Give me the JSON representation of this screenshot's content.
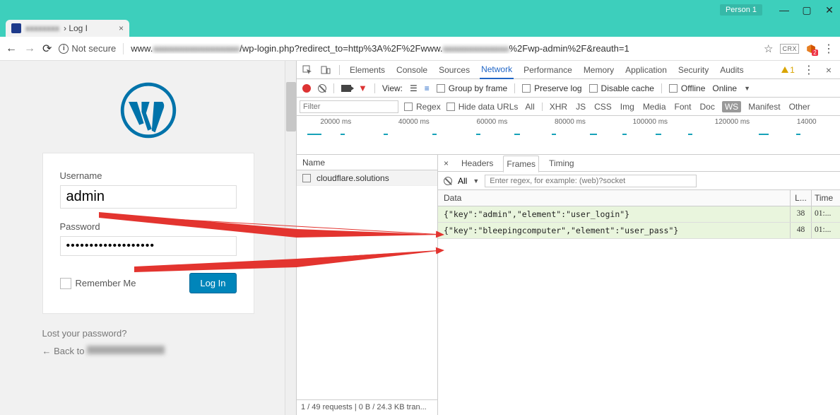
{
  "window": {
    "profile": "Person 1"
  },
  "tab": {
    "title_suffix": "› Log I"
  },
  "omnibox": {
    "security": "Not secure",
    "url_pre": "www.",
    "url_mid": "/wp-login.php?redirect_to=http%3A%2F%2Fwww.",
    "url_suf": "%2Fwp-admin%2F&reauth=1",
    "crx": "CRX",
    "cube_badge": "2"
  },
  "wp": {
    "username_label": "Username",
    "username_value": "admin",
    "password_label": "Password",
    "password_value": "•••••••••••••••••••",
    "remember": "Remember Me",
    "submit": "Log In",
    "lost": "Lost your password?",
    "back": "← Back to"
  },
  "devtools": {
    "tabs": [
      "Elements",
      "Console",
      "Sources",
      "Network",
      "Performance",
      "Memory",
      "Application",
      "Security",
      "Audits"
    ],
    "active_tab": "Network",
    "warn_count": "1",
    "toolbar": {
      "view": "View:",
      "group": "Group by frame",
      "preserve": "Preserve log",
      "disable": "Disable cache",
      "offline": "Offline",
      "online": "Online"
    },
    "filter": {
      "placeholder": "Filter",
      "regex": "Regex",
      "hide": "Hide data URLs",
      "types": [
        "All",
        "XHR",
        "JS",
        "CSS",
        "Img",
        "Media",
        "Font",
        "Doc",
        "WS",
        "Manifest",
        "Other"
      ]
    },
    "ticks": [
      "20000 ms",
      "40000 ms",
      "60000 ms",
      "80000 ms",
      "100000 ms",
      "120000 ms",
      "14000"
    ],
    "reqlist": {
      "header": "Name",
      "rows": [
        "cloudflare.solutions"
      ],
      "footer": "1 / 49 requests | 0 B / 24.3 KB tran..."
    },
    "detail": {
      "tabs": [
        "Headers",
        "Frames",
        "Timing"
      ],
      "active": "Frames",
      "all": "All",
      "regex_placeholder": "Enter regex, for example: (web)?socket",
      "cols": {
        "data": "Data",
        "len": "L...",
        "time": "Time"
      },
      "rows": [
        {
          "data": "{\"key\":\"admin\",\"element\":\"user_login\"}",
          "len": "38",
          "time": "01:..."
        },
        {
          "data": "{\"key\":\"bleepingcomputer\",\"element\":\"user_pass\"}",
          "len": "48",
          "time": "01:..."
        }
      ]
    }
  }
}
